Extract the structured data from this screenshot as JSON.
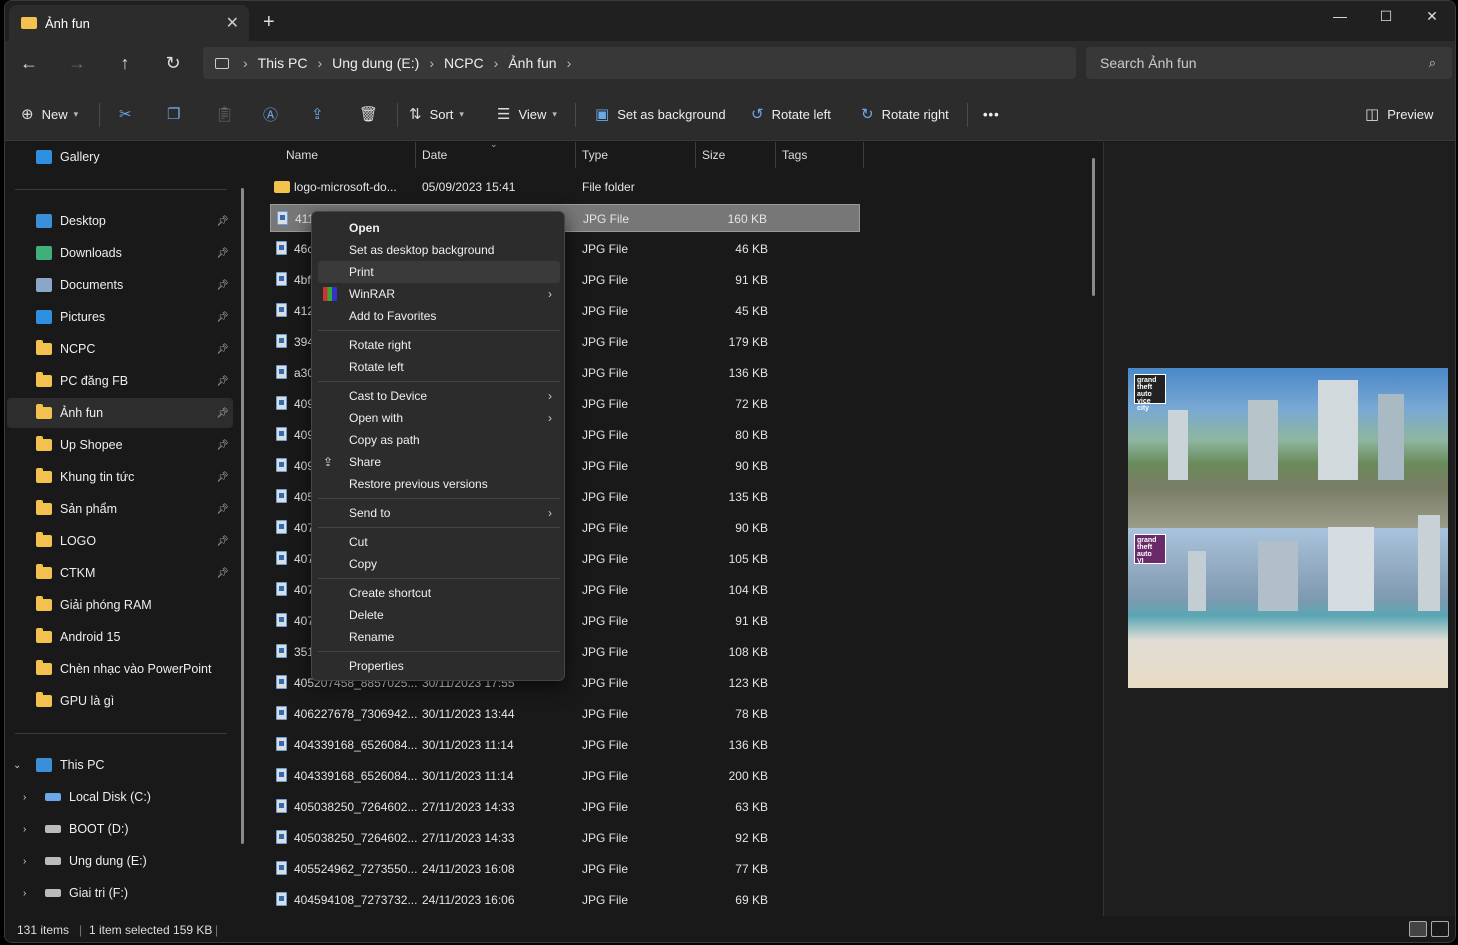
{
  "window": {
    "tab_title": "Ảnh fun",
    "new_tab": "+",
    "minimize": "—",
    "maximize": "☐",
    "close": "✕"
  },
  "nav": {
    "back": "←",
    "forward": "→",
    "up": "↑",
    "refresh": "↻"
  },
  "breadcrumb": [
    "This PC",
    "Ung dung (E:)",
    "NCPC",
    "Ảnh fun"
  ],
  "search": {
    "placeholder": "Search Ảnh fun"
  },
  "toolbar": {
    "new_label": "New",
    "sort_label": "Sort",
    "view_label": "View",
    "set_bg_label": "Set as background",
    "rotate_left_label": "Rotate left",
    "rotate_right_label": "Rotate right",
    "more_label": "•••",
    "preview_label": "Preview"
  },
  "sidebar": {
    "gallery": "Gallery",
    "quick_access": [
      {
        "label": "Desktop",
        "icon": "desktop-icon",
        "color": "#3b8fd9"
      },
      {
        "label": "Downloads",
        "icon": "download-icon",
        "color": "#3fb07a"
      },
      {
        "label": "Documents",
        "icon": "documents-icon",
        "color": "#8aa6c8"
      },
      {
        "label": "Pictures",
        "icon": "pictures-icon",
        "color": "#2f8fe0"
      },
      {
        "label": "NCPC",
        "icon": "folder-icon"
      },
      {
        "label": "PC đăng FB",
        "icon": "folder-icon"
      },
      {
        "label": "Ảnh fun",
        "icon": "folder-icon"
      },
      {
        "label": "Up Shopee",
        "icon": "folder-icon"
      },
      {
        "label": "Khung tin tức",
        "icon": "folder-icon"
      },
      {
        "label": "Sản phẩm",
        "icon": "folder-icon"
      },
      {
        "label": "LOGO",
        "icon": "folder-icon"
      },
      {
        "label": "CTKM",
        "icon": "folder-icon"
      },
      {
        "label": "Giải phóng RAM",
        "icon": "folder-icon"
      },
      {
        "label": "Android 15",
        "icon": "folder-icon"
      },
      {
        "label": "Chèn nhạc vào PowerPoint",
        "icon": "folder-icon"
      },
      {
        "label": "GPU là gì",
        "icon": "folder-icon"
      }
    ],
    "this_pc": "This PC",
    "drives": [
      "Local Disk (C:)",
      "BOOT (D:)",
      "Ung dung (E:)",
      "Giai tri (F:)"
    ]
  },
  "columns": [
    "Name",
    "Date",
    "Type",
    "Size",
    "Tags"
  ],
  "files": [
    {
      "name": "logo-microsoft-do...",
      "date": "05/09/2023 15:41",
      "type": "File folder",
      "size": ""
    },
    {
      "name": "411",
      "date": "",
      "type": "JPG File",
      "size": "160 KB"
    },
    {
      "name": "46c",
      "date": "",
      "type": "JPG File",
      "size": "46 KB"
    },
    {
      "name": "4bf",
      "date": "",
      "type": "JPG File",
      "size": "91 KB"
    },
    {
      "name": "412",
      "date": "",
      "type": "JPG File",
      "size": "45 KB"
    },
    {
      "name": "394",
      "date": "",
      "type": "JPG File",
      "size": "179 KB"
    },
    {
      "name": "a30",
      "date": "",
      "type": "JPG File",
      "size": "136 KB"
    },
    {
      "name": "409",
      "date": "",
      "type": "JPG File",
      "size": "72 KB"
    },
    {
      "name": "409",
      "date": "",
      "type": "JPG File",
      "size": "80 KB"
    },
    {
      "name": "409",
      "date": "",
      "type": "JPG File",
      "size": "90 KB"
    },
    {
      "name": "405",
      "date": "",
      "type": "JPG File",
      "size": "135 KB"
    },
    {
      "name": "407",
      "date": "",
      "type": "JPG File",
      "size": "90 KB"
    },
    {
      "name": "407",
      "date": "",
      "type": "JPG File",
      "size": "105 KB"
    },
    {
      "name": "407",
      "date": "",
      "type": "JPG File",
      "size": "104 KB"
    },
    {
      "name": "407",
      "date": "",
      "type": "JPG File",
      "size": "91 KB"
    },
    {
      "name": "351",
      "date": "",
      "type": "JPG File",
      "size": "108 KB"
    },
    {
      "name": "405207458_8857025...",
      "date": "30/11/2023 17:55",
      "type": "JPG File",
      "size": "123 KB"
    },
    {
      "name": "406227678_7306942...",
      "date": "30/11/2023 13:44",
      "type": "JPG File",
      "size": "78 KB"
    },
    {
      "name": "404339168_6526084...",
      "date": "30/11/2023 11:14",
      "type": "JPG File",
      "size": "136 KB"
    },
    {
      "name": "404339168_6526084...",
      "date": "30/11/2023 11:14",
      "type": "JPG File",
      "size": "200 KB"
    },
    {
      "name": "405038250_7264602...",
      "date": "27/11/2023 14:33",
      "type": "JPG File",
      "size": "63 KB"
    },
    {
      "name": "405038250_7264602...",
      "date": "27/11/2023 14:33",
      "type": "JPG File",
      "size": "92 KB"
    },
    {
      "name": "405524962_7273550...",
      "date": "24/11/2023 16:08",
      "type": "JPG File",
      "size": "77 KB"
    },
    {
      "name": "404594108_7273732...",
      "date": "24/11/2023 16:06",
      "type": "JPG File",
      "size": "69 KB"
    }
  ],
  "context_menu": {
    "groups": [
      [
        "Open",
        "Set as desktop background",
        "Print",
        "WinRAR",
        "Add to Favorites"
      ],
      [
        "Rotate right",
        "Rotate left"
      ],
      [
        "Cast to Device",
        "Open with",
        "Copy as path",
        "Share",
        "Restore previous versions"
      ],
      [
        "Send to"
      ],
      [
        "Cut",
        "Copy"
      ],
      [
        "Create shortcut",
        "Delete",
        "Rename"
      ],
      [
        "Properties"
      ]
    ]
  },
  "preview_images": {
    "top_logo": "grand\ntheft\nauto\nvice city",
    "bottom_logo": "grand\ntheft\nauto\nVI"
  },
  "status": {
    "count": "131 items",
    "selection": "1 item selected  159 KB"
  }
}
